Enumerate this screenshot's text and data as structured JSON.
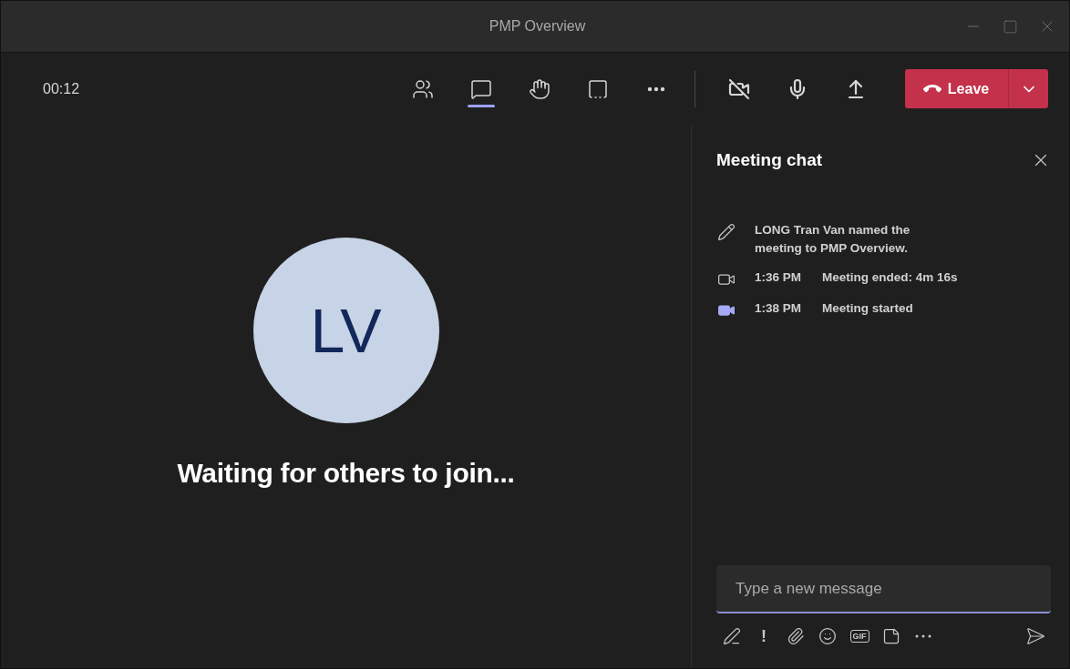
{
  "window": {
    "title": "PMP Overview"
  },
  "toolbar": {
    "timer": "00:12",
    "tools": [
      {
        "kind": "people",
        "selected": false
      },
      {
        "kind": "chat",
        "selected": true
      },
      {
        "kind": "hand",
        "selected": false
      },
      {
        "kind": "rooms",
        "selected": false
      },
      {
        "kind": "more",
        "selected": false
      }
    ],
    "controls": [
      {
        "kind": "camera"
      },
      {
        "kind": "mic"
      },
      {
        "kind": "share"
      }
    ],
    "leave": {
      "label": "Leave"
    }
  },
  "stage": {
    "initials": "LV",
    "status": "Waiting for others to join..."
  },
  "chat": {
    "title": "Meeting chat",
    "events": [
      {
        "kind": "rename",
        "text": "LONG Tran Van named the meeting to PMP Overview."
      },
      {
        "kind": "ended",
        "time": "1:36 PM",
        "text": "Meeting ended: **4m 16s**"
      },
      {
        "kind": "started",
        "time": "1:38 PM",
        "text": "Meeting started"
      }
    ],
    "composer": {
      "placeholder": "Type a new message"
    },
    "tools": [
      {
        "kind": "format"
      },
      {
        "kind": "important",
        "label": "!"
      },
      {
        "kind": "attach"
      },
      {
        "kind": "emoji"
      },
      {
        "kind": "gif",
        "label": "GIF"
      },
      {
        "kind": "sticker"
      },
      {
        "kind": "more"
      }
    ]
  }
}
